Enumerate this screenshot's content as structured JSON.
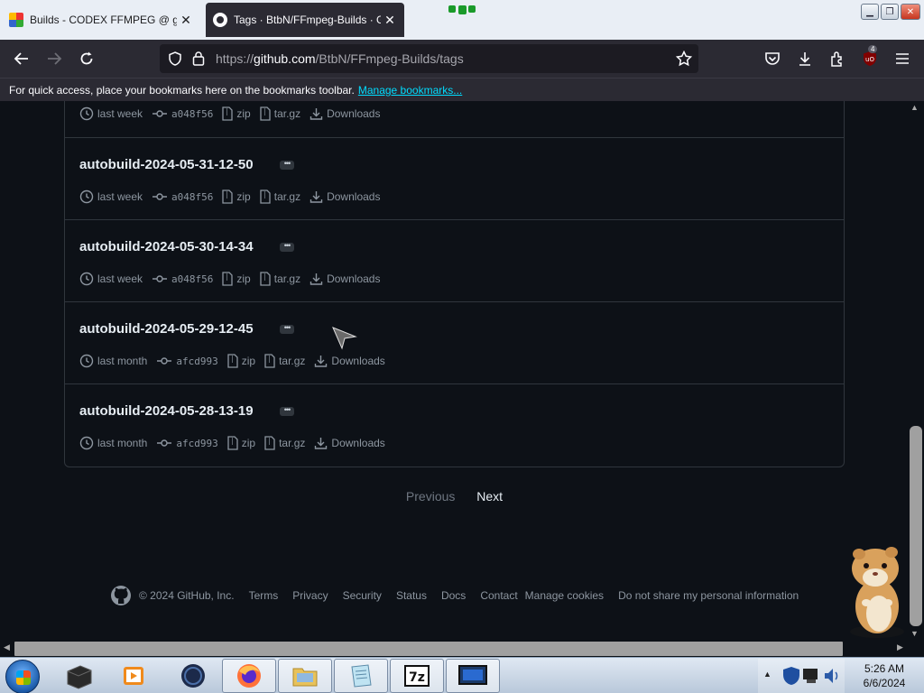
{
  "browser": {
    "tabs": [
      {
        "title": "Builds - CODEX FFMPEG @ gyan.",
        "active": false
      },
      {
        "title": "Tags · BtbN/FFmpeg-Builds · G",
        "active": true
      }
    ],
    "url_prefix": "https://",
    "url_host": "github.com",
    "url_path": "/BtbN/FFmpeg-Builds/tags",
    "extension_badge": "4",
    "bookmarks_bar_text": "For quick access, place your bookmarks here on the bookmarks toolbar.",
    "bookmarks_bar_link": "Manage bookmarks..."
  },
  "tags": [
    {
      "name": "",
      "date": "last week",
      "sha": "a048f56",
      "zip": "zip",
      "targz": "tar.gz",
      "downloads": "Downloads"
    },
    {
      "name": "autobuild-2024-05-31-12-50",
      "date": "last week",
      "sha": "a048f56",
      "zip": "zip",
      "targz": "tar.gz",
      "downloads": "Downloads"
    },
    {
      "name": "autobuild-2024-05-30-14-34",
      "date": "last week",
      "sha": "a048f56",
      "zip": "zip",
      "targz": "tar.gz",
      "downloads": "Downloads"
    },
    {
      "name": "autobuild-2024-05-29-12-45",
      "date": "last month",
      "sha": "afcd993",
      "zip": "zip",
      "targz": "tar.gz",
      "downloads": "Downloads"
    },
    {
      "name": "autobuild-2024-05-28-13-19",
      "date": "last month",
      "sha": "afcd993",
      "zip": "zip",
      "targz": "tar.gz",
      "downloads": "Downloads"
    }
  ],
  "pagination": {
    "previous": "Previous",
    "next": "Next"
  },
  "footer": {
    "copyright": "© 2024 GitHub, Inc.",
    "links": [
      "Terms",
      "Privacy",
      "Security",
      "Status",
      "Docs",
      "Contact",
      "Manage cookies",
      "Do not share my personal information"
    ]
  },
  "taskbar": {
    "time": "5:26 AM",
    "date": "6/6/2024"
  },
  "colors": {
    "page_bg": "#0d1117",
    "text": "#e6edf3",
    "muted": "#8d96a0",
    "border": "#30363d",
    "link": "#00ddff"
  }
}
